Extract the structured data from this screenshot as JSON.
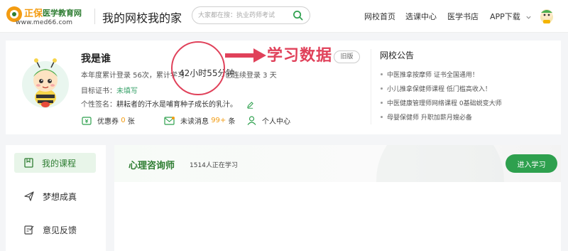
{
  "header": {
    "logo_zheng": "正保",
    "logo_name": "医学教育网",
    "logo_url": "www.med66.com",
    "site_title": "我的网校我的家",
    "search_placeholder": "大家都在搜：执业药师考试",
    "nav": [
      "网校首页",
      "选课中心",
      "医学书店",
      "APP下载"
    ]
  },
  "profile": {
    "name": "我是谁",
    "login_stats": "本年度累计登录 56次，累计学习",
    "study_time": "42小时55分钟",
    "continuous_login": "已连续登录 3 天",
    "old_version": "旧版",
    "cert_label": "目标证书：",
    "cert_value": "未填写",
    "signature_label": "个性签名：",
    "signature_value": "耕耘者的汗水是哺育种子成长的乳汁。",
    "coupon_label": "优惠券",
    "coupon_count": "0",
    "coupon_unit": "张",
    "unread_label": "未读消息",
    "unread_count": "99+",
    "unread_unit": "条",
    "personal_center": "个人中心"
  },
  "annotation": {
    "text": "学习数据"
  },
  "notice": {
    "title": "网校公告",
    "items": [
      "中医推拿按摩师 证书全国通用！",
      "小儿推拿保健师课程 低门槛高收入！",
      "中医健康管理师网络课程 0基础蜕变大师",
      "母婴保健师 升职加薪月嫂必备"
    ]
  },
  "sidebar": {
    "items": [
      "我的课程",
      "梦想成真",
      "意见反馈"
    ]
  },
  "course": {
    "name": "心理咨询师",
    "learners": "1514人正在学习",
    "enter_label": "进入学习"
  },
  "colors": {
    "brand_green": "#2ea04e",
    "brand_orange": "#f39c12",
    "annotation_red": "#e0415a"
  }
}
